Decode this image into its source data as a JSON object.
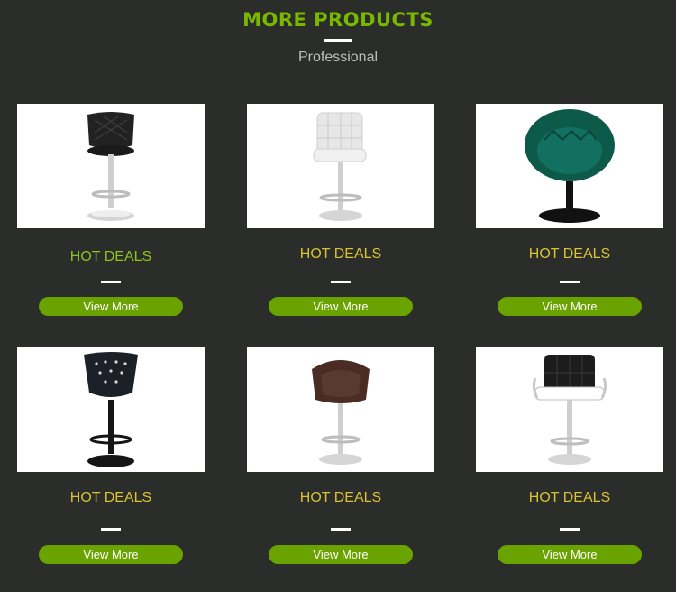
{
  "header": {
    "title": "MORE PRODUCTS",
    "subtitle": "Professional"
  },
  "colors": {
    "background": "#2b2d2a",
    "accent_green": "#7ab800",
    "deal_gold": "#d9c233",
    "button_green": "#6aa200"
  },
  "products": [
    {
      "deal_label": "HOT DEALS",
      "button_label": "View More",
      "image": "black-diamond-stitched-bar-stool"
    },
    {
      "deal_label": "HOT DEALS",
      "button_label": "View More",
      "image": "white-square-stitched-bar-stool"
    },
    {
      "deal_label": "HOT DEALS",
      "button_label": "View More",
      "image": "green-velvet-round-swivel-chair"
    },
    {
      "deal_label": "HOT DEALS",
      "button_label": "View More",
      "image": "black-crystal-tufted-bar-stool"
    },
    {
      "deal_label": "HOT DEALS",
      "button_label": "View More",
      "image": "brown-leather-bar-stool"
    },
    {
      "deal_label": "HOT DEALS",
      "button_label": "View More",
      "image": "black-white-armrest-bar-stool"
    }
  ]
}
